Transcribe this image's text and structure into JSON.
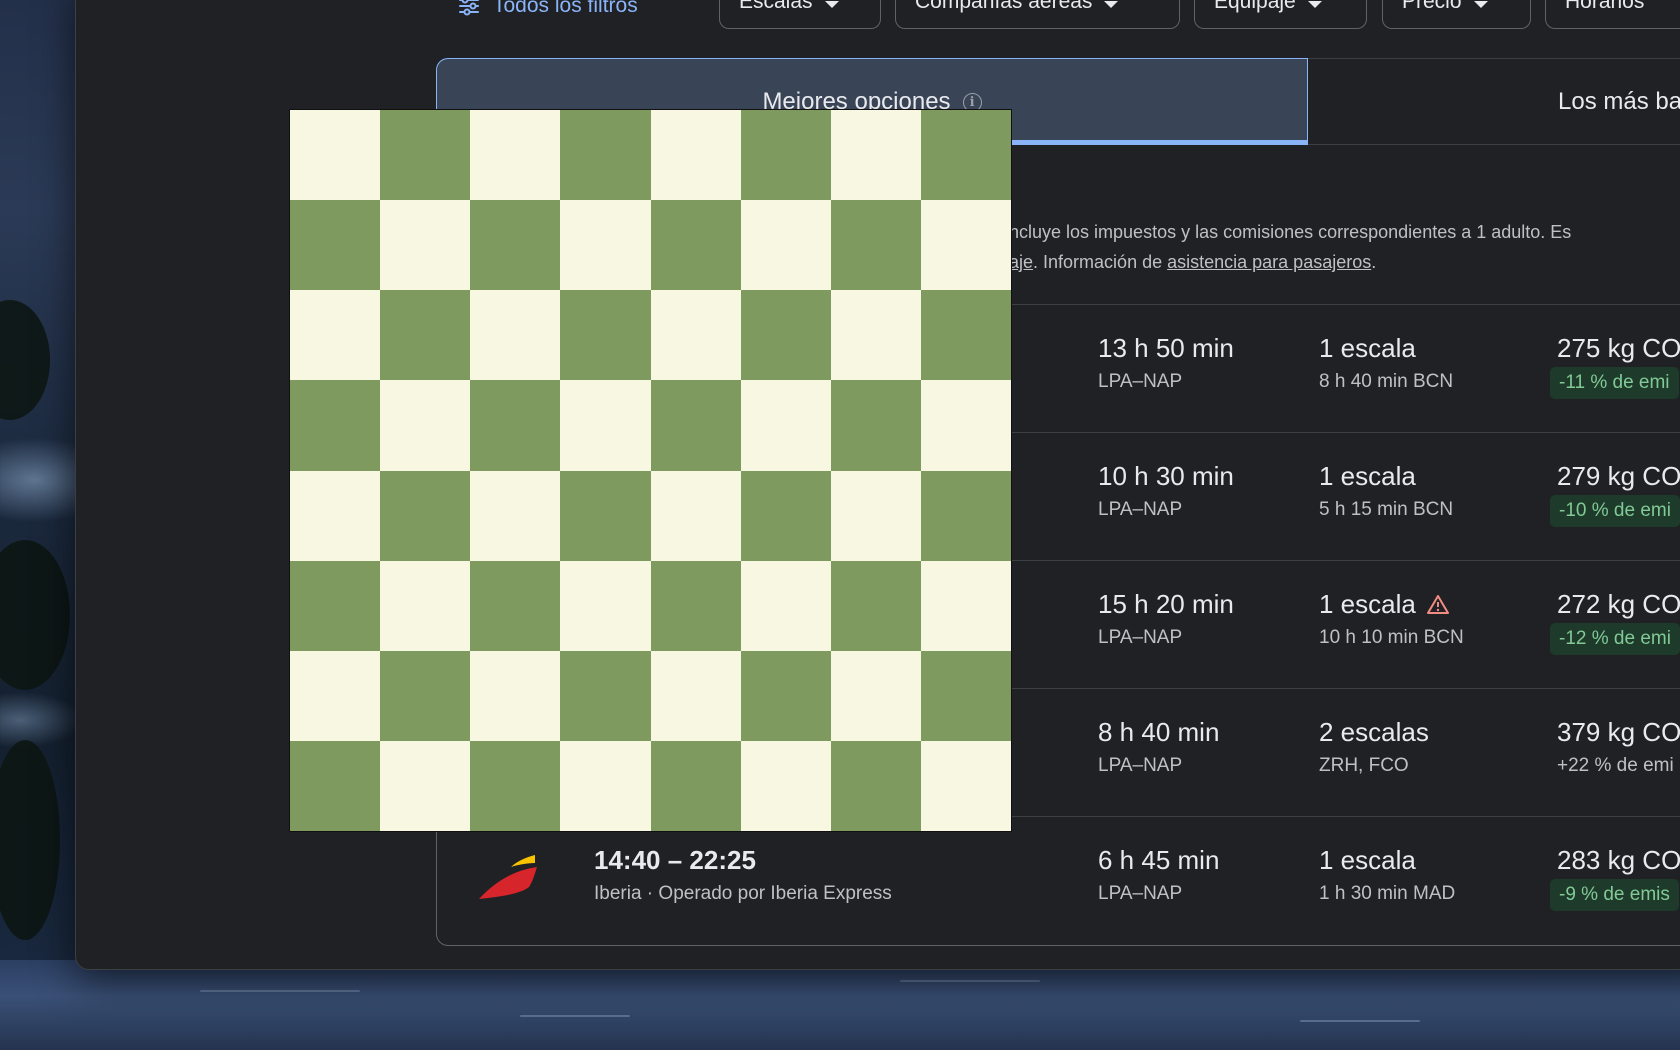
{
  "filters": {
    "all_filters": "Todos los filtros",
    "chips": [
      "Escalas",
      "Compañías aéreas",
      "Equipaje",
      "Precio",
      "Horarios"
    ]
  },
  "tabs": {
    "active": "Mejores opciones",
    "second": "Los más ba"
  },
  "info": {
    "line1": "ncluye los impuestos y las comisiones correspondientes a 1 adulto. Es",
    "line2_link1": "aje",
    "line2_text": ". Información de ",
    "line2_link2": "asistencia para pasajeros",
    "line2_end": "."
  },
  "results": [
    {
      "duration": "13 h 50 min",
      "route": "LPA–NAP",
      "stops": "1 escala",
      "layover": "8 h 40 min BCN",
      "co2": "275 kg CO",
      "emissions": "-11 % de emi",
      "warning": false,
      "emissions_style": "green"
    },
    {
      "duration": "10 h 30 min",
      "route": "LPA–NAP",
      "stops": "1 escala",
      "layover": "5 h 15 min BCN",
      "co2": "279 kg CO",
      "emissions": "-10 % de emi",
      "warning": false,
      "emissions_style": "green"
    },
    {
      "duration": "15 h 20 min",
      "route": "LPA–NAP",
      "stops": "1 escala",
      "layover": "10 h 10 min BCN",
      "co2": "272 kg CO",
      "emissions": "-12 % de emi",
      "warning": true,
      "emissions_style": "green"
    },
    {
      "duration": "8 h 40 min",
      "route": "LPA–NAP",
      "stops": "2 escalas",
      "layover": "ZRH, FCO",
      "co2": "379 kg CO",
      "emissions": "+22 % de emi",
      "warning": false,
      "emissions_style": "plain"
    },
    {
      "times": "14:40 – 22:25",
      "airline": "Iberia · Operado por Iberia Express",
      "duration": "6 h 45 min",
      "route": "LPA–NAP",
      "stops": "1 escala",
      "layover": "1 h 30 min MAD",
      "co2": "283 kg CO",
      "emissions": "-9 % de emis",
      "warning": false,
      "emissions_style": "green"
    }
  ],
  "board": {
    "size": 8,
    "light_color": "#f8f8e2",
    "dark_color": "#7f9a5e"
  }
}
